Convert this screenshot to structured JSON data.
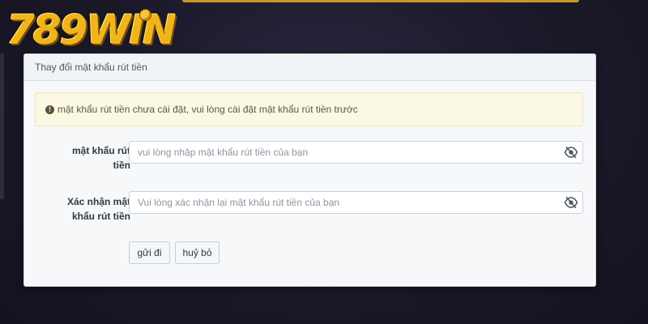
{
  "brand": {
    "logo_text": "789WIN"
  },
  "modal": {
    "title": "Thay đổi mật khẩu rút tiền",
    "alert": {
      "icon": "exclamation-circle-icon",
      "text": "mật khẩu rút tiền chưa cài đặt, vui lòng cài đặt mật khẩu rút tiền trước"
    },
    "fields": [
      {
        "label_line1": "mật khẩu rút",
        "label_line2": "tiền",
        "value": "",
        "placeholder": "vui lòng nhập mật khẩu rút tiền của bạn",
        "toggle_icon": "eye-slash-icon"
      },
      {
        "label_line1": "Xác nhận mật",
        "label_line2": "khẩu rút tiền",
        "value": "",
        "placeholder": "Vui lòng xác nhận lại mật khẩu rút tiền của bạn",
        "toggle_icon": "eye-slash-icon"
      }
    ],
    "buttons": {
      "submit_label": "gửi đi",
      "cancel_label": "huỷ bỏ"
    }
  },
  "colors": {
    "background": "#1b1828",
    "logo_gold": "#f1b51c",
    "alert_background": "#fbf8e4",
    "modal_background": "#f7f8fa"
  }
}
